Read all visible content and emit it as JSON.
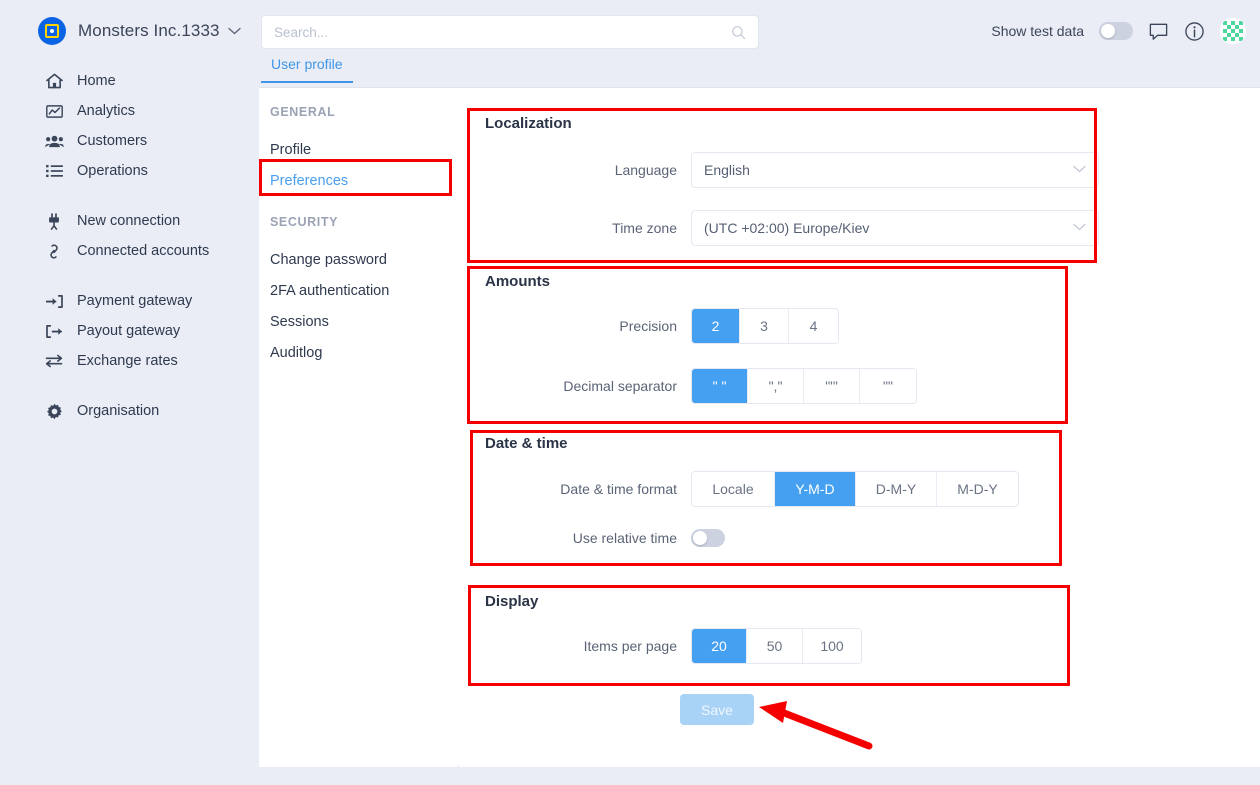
{
  "topbar": {
    "brand_name": "Monsters Inc.1333",
    "brand_caret": "⌄",
    "logo_icon": "app-logo-icon",
    "search": {
      "value": "",
      "placeholder": "Search..."
    },
    "test_data_label": "Show test data",
    "test_data_on": false,
    "chat_icon": "chat-bubble-icon",
    "info_icon": "info-circle-icon",
    "avatar_icon": "user-avatar-identicon"
  },
  "sidebar": {
    "groups": [
      {
        "items": [
          {
            "label": "Home",
            "icon": "home-icon"
          },
          {
            "label": "Analytics",
            "icon": "chart-line-icon"
          },
          {
            "label": "Customers",
            "icon": "users-icon"
          },
          {
            "label": "Operations",
            "icon": "list-icon"
          }
        ]
      },
      {
        "items": [
          {
            "label": "New connection",
            "icon": "plug-icon"
          },
          {
            "label": "Connected accounts",
            "icon": "link-icon"
          }
        ]
      },
      {
        "items": [
          {
            "label": "Payment gateway",
            "icon": "arrow-into-bracket-icon"
          },
          {
            "label": "Payout gateway",
            "icon": "arrow-out-bracket-icon"
          },
          {
            "label": "Exchange rates",
            "icon": "exchange-arrows-icon"
          }
        ]
      },
      {
        "items": [
          {
            "label": "Organisation",
            "icon": "gear-icon"
          }
        ]
      }
    ]
  },
  "tab": {
    "label": "User profile"
  },
  "subnav": {
    "general_heading": "GENERAL",
    "general_items": [
      {
        "label": "Profile",
        "active": false
      },
      {
        "label": "Preferences",
        "active": true
      }
    ],
    "security_heading": "SECURITY",
    "security_items": [
      {
        "label": "Change password",
        "active": false
      },
      {
        "label": "2FA authentication",
        "active": false
      },
      {
        "label": "Sessions",
        "active": false
      },
      {
        "label": "Auditlog",
        "active": false
      }
    ]
  },
  "localization": {
    "title": "Localization",
    "language_label": "Language",
    "language_value": "English",
    "timezone_label": "Time zone",
    "timezone_value": "(UTC +02:00) Europe/Kiev",
    "chevron": "⌄"
  },
  "amounts": {
    "title": "Amounts",
    "precision_label": "Precision",
    "precision_options": [
      "2",
      "3",
      "4"
    ],
    "precision_selected": 0,
    "separator_label": "Decimal separator",
    "separator_options": [
      "\" \"",
      "\",\"",
      "\"'\"",
      "\"\""
    ],
    "separator_selected": 0
  },
  "datetime": {
    "title": "Date & time",
    "format_label": "Date & time format",
    "format_options": [
      "Locale",
      "Y-M-D",
      "D-M-Y",
      "M-D-Y"
    ],
    "format_selected": 1,
    "relative_label": "Use relative time",
    "relative_on": false
  },
  "display": {
    "title": "Display",
    "items_label": "Items per page",
    "items_options": [
      "20",
      "50",
      "100"
    ],
    "items_selected": 0
  },
  "actions": {
    "save_label": "Save"
  },
  "colors": {
    "accent": "#45a0f2",
    "page_bg": "#eaedf5",
    "panel_bg": "#ffffff",
    "highlight": "#f40000",
    "brand_blue": "#0b63e5",
    "brand_yellow": "#ffd200"
  }
}
